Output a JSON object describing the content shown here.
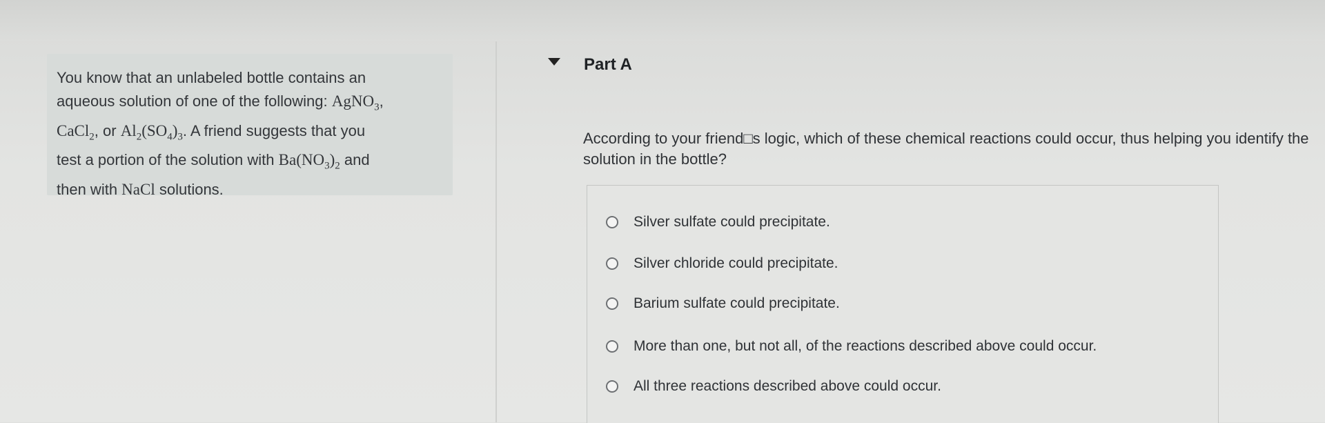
{
  "problem": {
    "t1": "You know that an unlabeled bottle contains an",
    "t2": "aqueous solution of one of the following: ",
    "c1": "AgNO",
    "c1s": "3",
    "t3": ",",
    "c2": "CaCl",
    "c2s": "2",
    "t4": ", or ",
    "c3a": "Al",
    "c3as": "2",
    "c3b": "(SO",
    "c3bs": "4",
    "c3c": ")",
    "c3cs": "3",
    "t5": ". A friend suggests that you",
    "t6": "test a portion of the solution with ",
    "c4a": "Ba(NO",
    "c4as": "3",
    "c4b": ")",
    "c4bs": "2",
    "t7": " and",
    "t8": "then with ",
    "c5": "NaCl",
    "t9": " solutions."
  },
  "part": {
    "title": "Part A",
    "question": "According to your friend□s logic, which of these chemical reactions could occur, thus helping you identify the solution in the bottle?"
  },
  "options": [
    "Silver sulfate could precipitate.",
    "Silver chloride could precipitate.",
    "Barium sulfate could precipitate.",
    "More than one, but not all, of the reactions described above could occur.",
    "All three reactions described above could occur."
  ]
}
